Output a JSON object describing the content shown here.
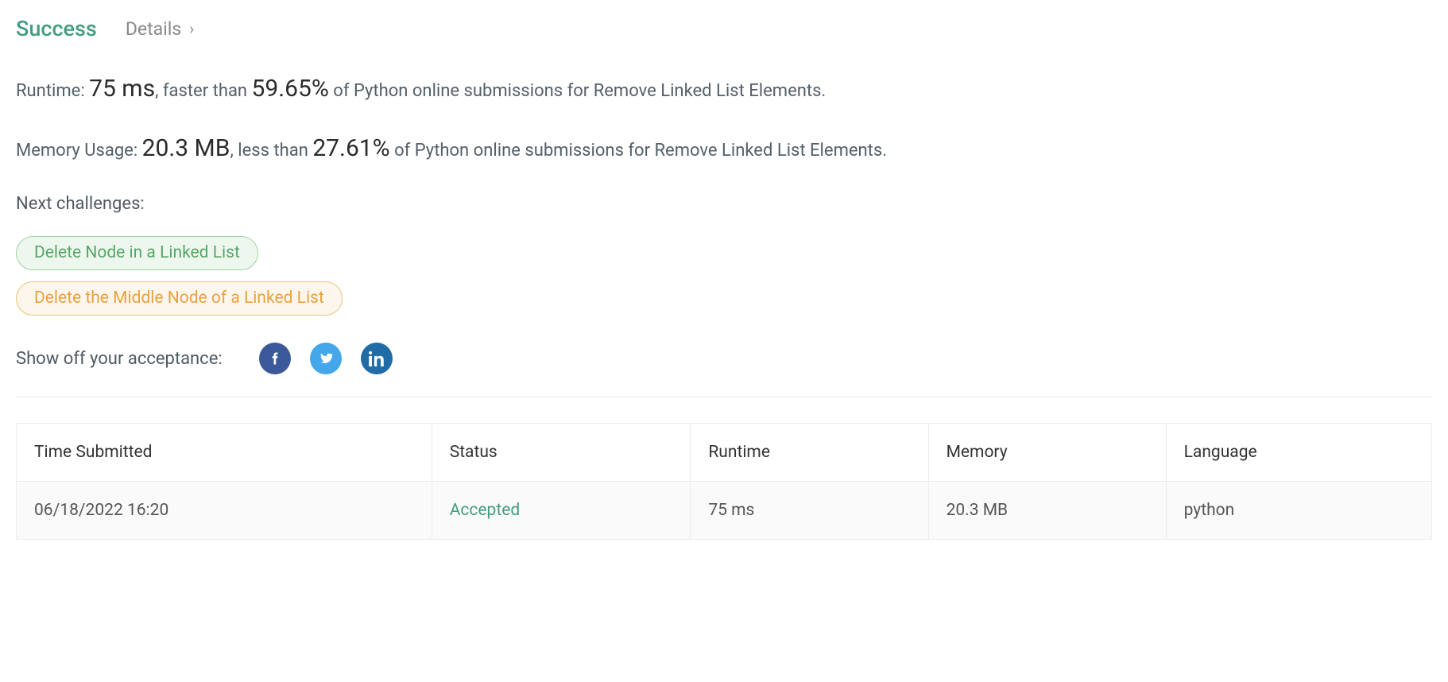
{
  "header": {
    "status_title": "Success",
    "details_label": "Details"
  },
  "runtime": {
    "label": "Runtime: ",
    "value": "75 ms",
    "sep": ", faster than ",
    "percent": "59.65%",
    "tail": " of Python online submissions for Remove Linked List Elements."
  },
  "memory": {
    "label": "Memory Usage: ",
    "value": "20.3 MB",
    "sep": ", less than ",
    "percent": "27.61%",
    "tail": " of Python online submissions for Remove Linked List Elements."
  },
  "next_challenges_label": "Next challenges:",
  "challenges": {
    "c0": "Delete Node in a Linked List",
    "c1": "Delete the Middle Node of a Linked List"
  },
  "share_label": "Show off your acceptance:",
  "table": {
    "headers": {
      "time": "Time Submitted",
      "status": "Status",
      "runtime": "Runtime",
      "memory": "Memory",
      "language": "Language"
    },
    "row": {
      "time": "06/18/2022 16:20",
      "status": "Accepted",
      "runtime": "75 ms",
      "memory": "20.3 MB",
      "language": "python"
    }
  }
}
